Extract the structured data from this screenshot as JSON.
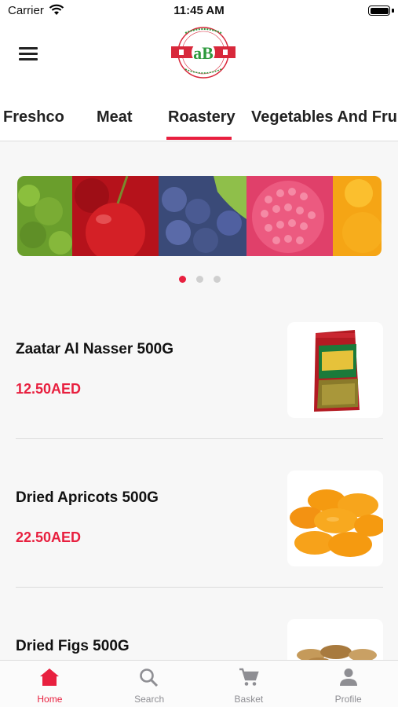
{
  "status_bar": {
    "carrier": "Carrier",
    "time": "11:45 AM"
  },
  "header": {
    "logo_text": "aB"
  },
  "categories": [
    "Freshco",
    "Meat",
    "Roastery",
    "Vegetables And Fruits"
  ],
  "active_category": "Roastery",
  "carousel": {
    "page_count": 3,
    "active_page": 1
  },
  "products": [
    {
      "name": "Zaatar Al Nasser 500G",
      "price": "12.50AED"
    },
    {
      "name": "Dried Apricots 500G",
      "price": "22.50AED"
    },
    {
      "name": "Dried Figs 500G",
      "price": ""
    }
  ],
  "tab_bar": [
    {
      "label": "Home",
      "icon": "home-icon",
      "active": true
    },
    {
      "label": "Search",
      "icon": "search-icon",
      "active": false
    },
    {
      "label": "Basket",
      "icon": "cart-icon",
      "active": false
    },
    {
      "label": "Profile",
      "icon": "profile-icon",
      "active": false
    }
  ],
  "colors": {
    "accent": "#e8203f",
    "inactive": "#8e8e93",
    "logo_green": "#2e9a3e"
  }
}
